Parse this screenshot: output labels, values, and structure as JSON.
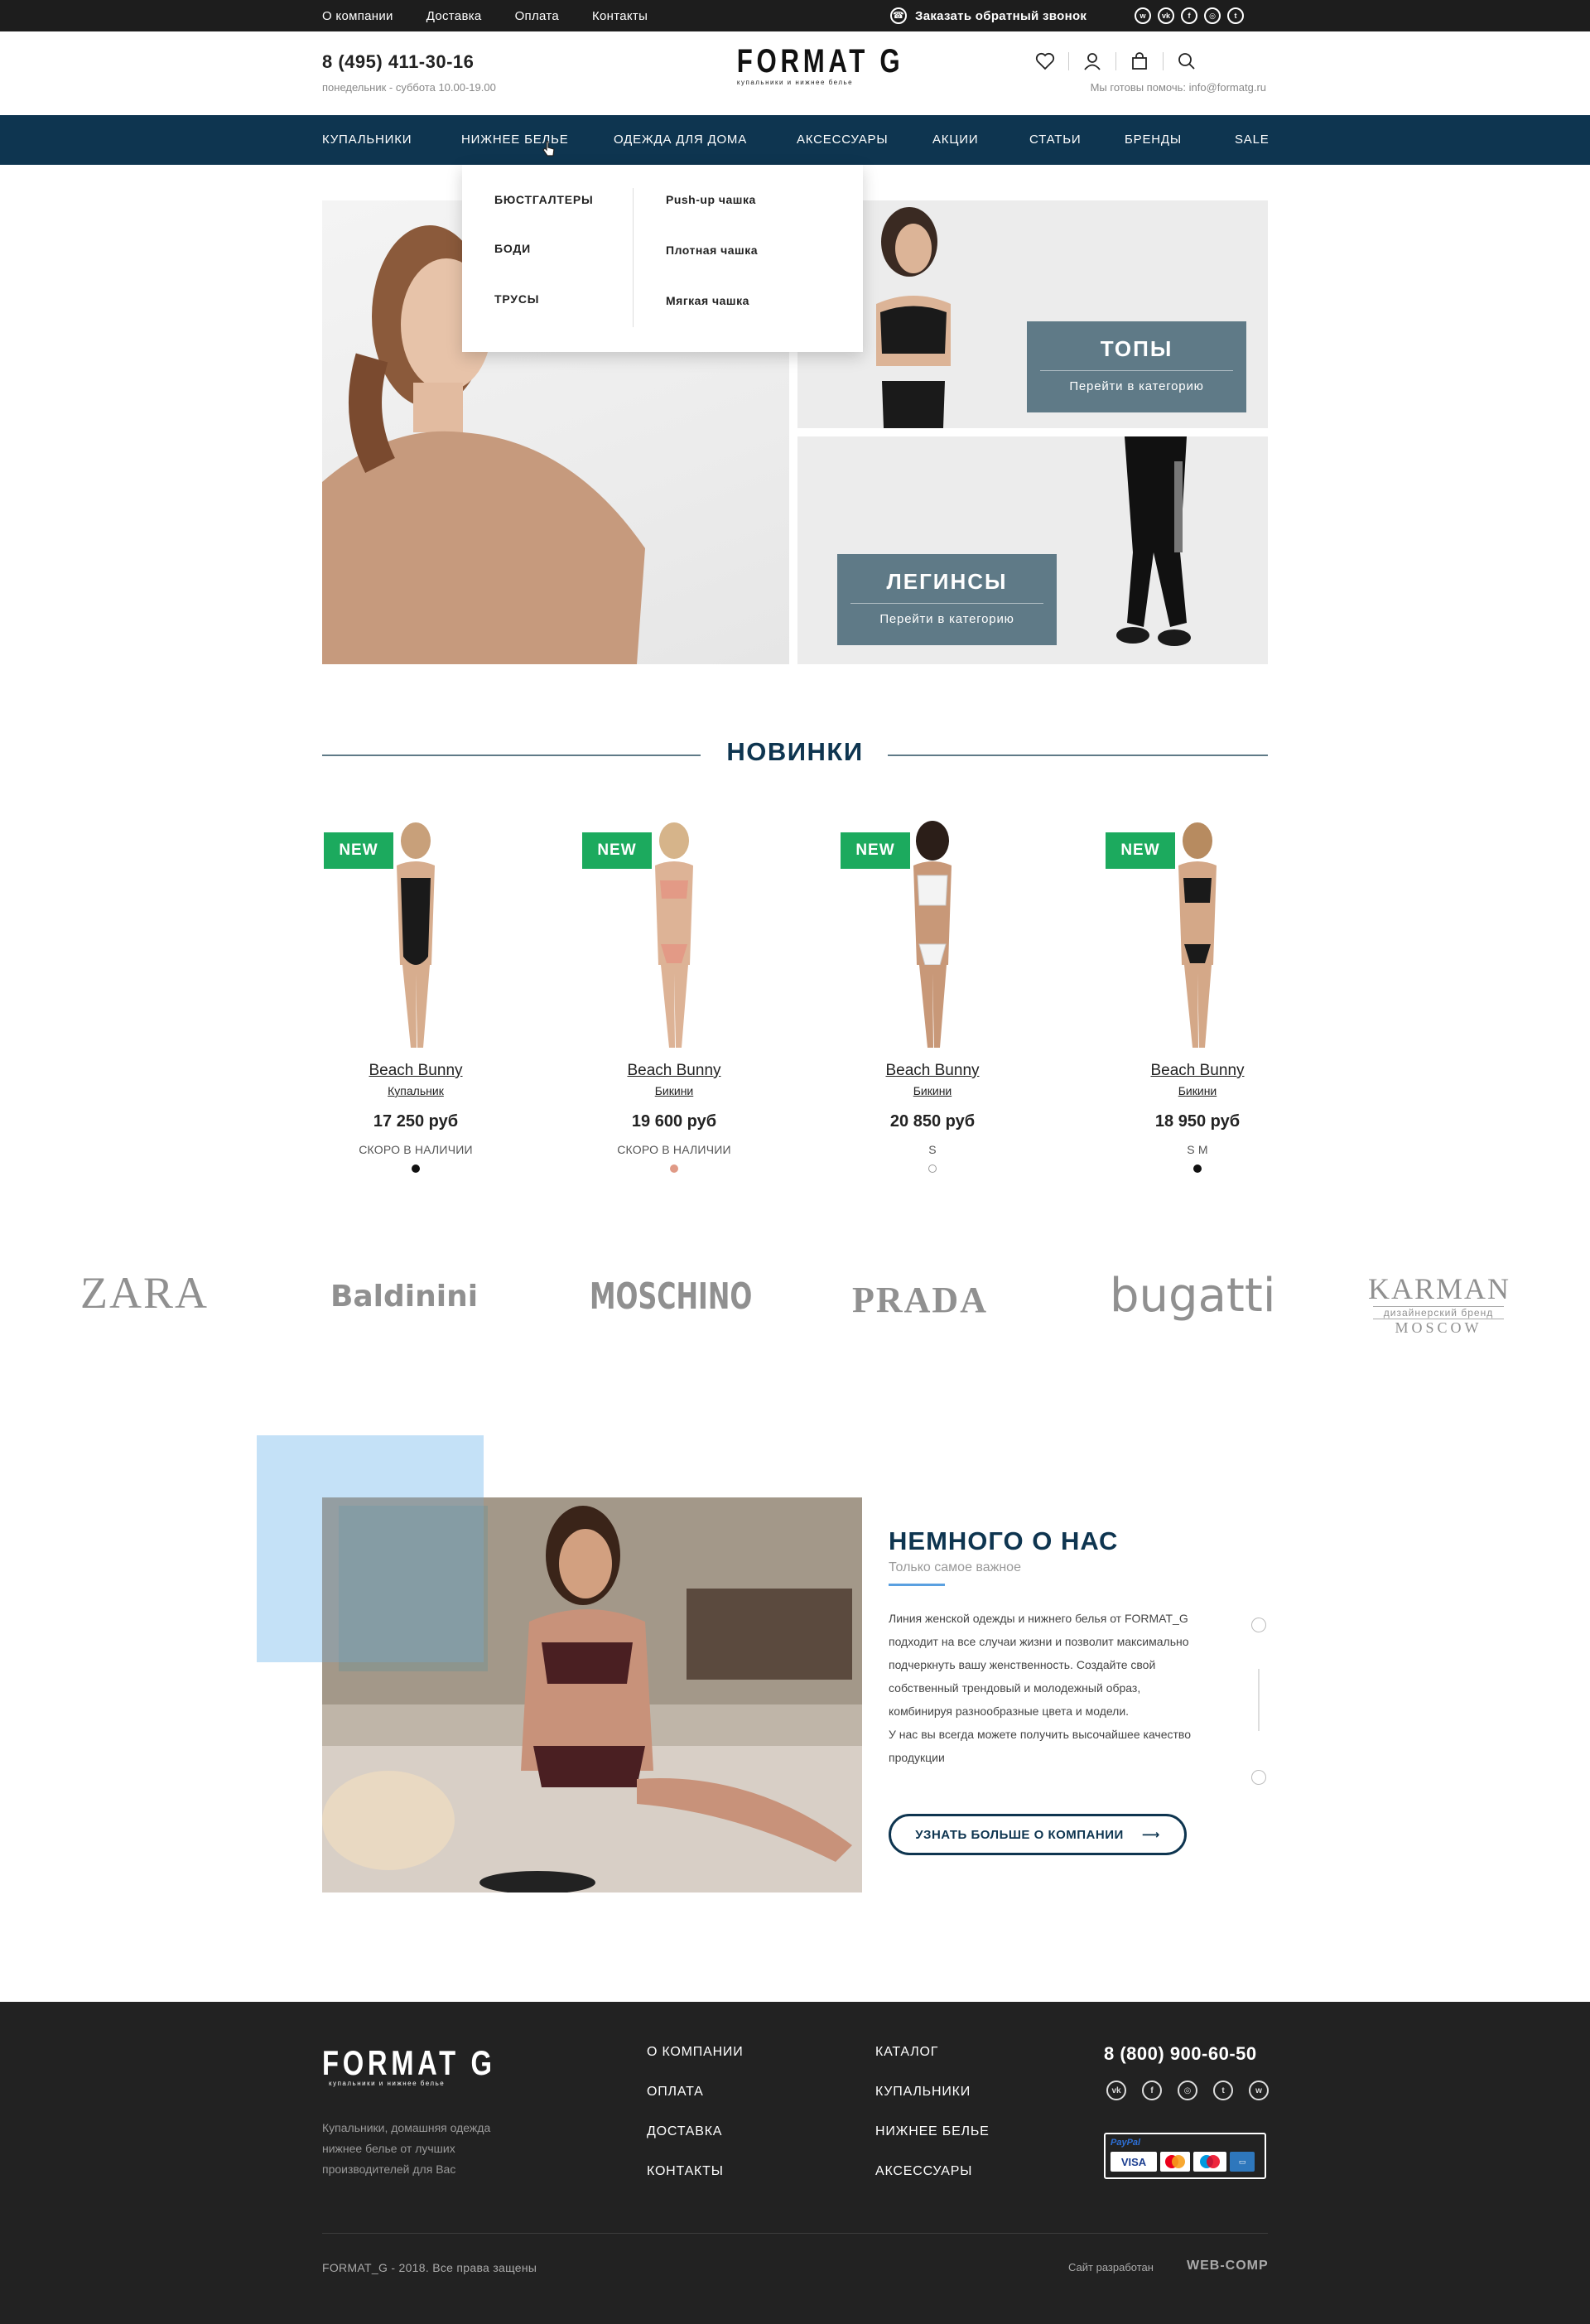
{
  "topbar": {
    "links": [
      "О компании",
      "Доставка",
      "Оплата",
      "Контакты"
    ],
    "callback": "Заказать обратный звонок",
    "socials": [
      "whatsapp-icon",
      "vk-icon",
      "facebook-icon",
      "instagram-icon",
      "twitter-icon"
    ]
  },
  "header": {
    "phone": "8 (495) 411-30-16",
    "hours": "понедельник - суббота 10.00-19.00",
    "logo_title": "FORMAT G",
    "logo_subtitle": "купальники и нижнее белье",
    "help": "Мы готовы помочь: info@formatg.ru",
    "icons": [
      "heart-icon",
      "user-icon",
      "bag-icon",
      "search-icon"
    ]
  },
  "nav": {
    "items": [
      "КУПАЛЬНИКИ",
      "НИЖНЕЕ БЕЛЬЕ",
      "ОДЕЖДА ДЛЯ ДОМА",
      "АКСЕССУАРЫ",
      "АКЦИИ",
      "СТАТЬИ",
      "БРЕНДЫ",
      "SALE"
    ]
  },
  "dropdown": {
    "categories": [
      "БЮСТГАЛТЕРЫ",
      "БОДИ",
      "ТРУСЫ"
    ],
    "subcategories": [
      "Push-up чашка",
      "Плотная чашка",
      "Мягкая чашка"
    ]
  },
  "banners": {
    "tops": {
      "title": "ТОПЫ",
      "link": "Перейти в категорию"
    },
    "leggings": {
      "title": "ЛЕГИНСЫ",
      "link": "Перейти в категорию"
    }
  },
  "new_section": {
    "title": "НОВИНКИ",
    "products": [
      {
        "badge": "NEW",
        "brand": "Beach Bunny",
        "type": "Купальник",
        "price": "17 250 руб",
        "status": "СКОРО В НАЛИЧИИ",
        "color": "#111111"
      },
      {
        "badge": "NEW",
        "brand": "Beach Bunny",
        "type": "Бикини",
        "price": "19 600 руб",
        "status": "СКОРО В НАЛИЧИИ",
        "color": "#e09a86"
      },
      {
        "badge": "NEW",
        "brand": "Beach Bunny",
        "type": "Бикини",
        "price": "20 850 руб",
        "status": "S",
        "color": "#ffffff"
      },
      {
        "badge": "NEW",
        "brand": "Beach Bunny",
        "type": "Бикини",
        "price": "18 950 руб",
        "status": "S   M",
        "color": "#111111"
      }
    ]
  },
  "brands": [
    "ZARA",
    "Baldinini",
    "MOSCHINO",
    "PRADA",
    "bugatti",
    "KARMAN",
    "дизайнерский бренд",
    "MOSCOW"
  ],
  "about": {
    "title": "НЕМНОГО О НАС",
    "subtitle": "Только самое важное",
    "text": "Линия женской одежды и нижнего белья от FORMAT_G подходит на все случаи жизни и позволит максимально подчеркнуть вашу женственность. Создайте свой собственный трендовый и молодежный образ, комбинируя разнообразные цвета и модели.",
    "text2": "У нас вы всегда можете получить высочайшее качество продукции",
    "button": "УЗНАТЬ БОЛЬШЕ О КОМПАНИИ"
  },
  "footer": {
    "logo_title": "FORMAT G",
    "logo_subtitle": "купальники и нижнее белье",
    "description": "Купальники, домашняя одежда нижнее белье от лучших производителей для Вас",
    "col1": [
      "О КОМПАНИИ",
      "ОПЛАТА",
      "ДОСТАВКА",
      "КОНТАКТЫ"
    ],
    "col2": [
      "КАТАЛОГ",
      "КУПАЛЬНИКИ",
      "НИЖНЕЕ БЕЛЬЕ",
      "АКСЕССУАРЫ"
    ],
    "phone": "8 (800) 900-60-50",
    "socials": [
      "vk-icon",
      "facebook-icon",
      "instagram-icon",
      "twitter-icon",
      "whatsapp-icon"
    ],
    "payment": {
      "paypal": "PayPal",
      "visa": "VISA"
    },
    "copyright": "FORMAT_G - 2018. Все права защены",
    "developer_label": "Сайт разработан",
    "developer": "WEB-COMP"
  },
  "colors": {
    "nav": "#0e3550",
    "accent": "#5f7a87",
    "badge": "#1caa5e",
    "footer": "#222222",
    "topbar": "#1d1d1d"
  }
}
